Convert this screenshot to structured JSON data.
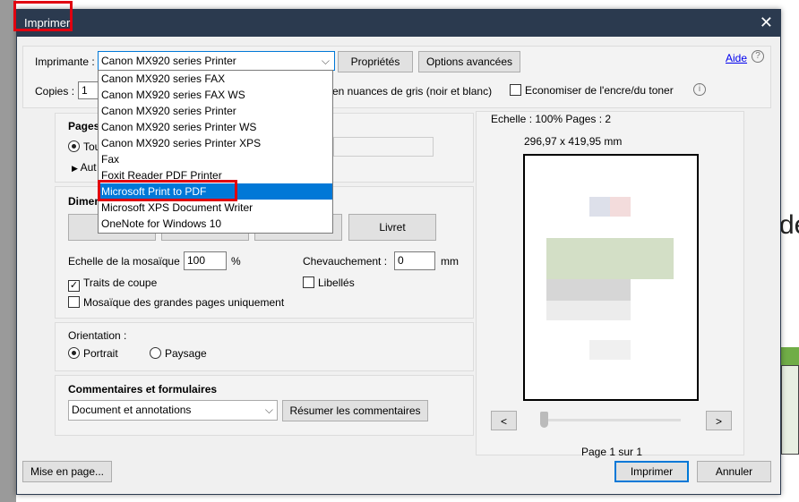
{
  "dialog": {
    "title": "Imprimer",
    "close": "✕"
  },
  "printer": {
    "label": "Imprimante :",
    "selected": "Canon MX920 series Printer",
    "properties": "Propriétés",
    "advanced": "Options avancées",
    "help": "Aide",
    "options": [
      "Canon MX920 series FAX",
      "Canon MX920 series FAX WS",
      "Canon MX920 series Printer",
      "Canon MX920 series Printer WS",
      "Canon MX920 series Printer XPS",
      "Fax",
      "Foxit Reader PDF Printer",
      "Microsoft Print to PDF",
      "Microsoft XPS Document Writer",
      "OneNote for Windows 10"
    ],
    "highlighted_index": 7
  },
  "copies": {
    "label": "Copies :",
    "value": "1",
    "grayscale": "en nuances de gris (noir et blanc)",
    "save_ink": "Economiser de l'encre/du toner"
  },
  "pages": {
    "title": "Pages",
    "all": "Tou",
    "more": "Aut"
  },
  "size": {
    "title": "Dimer",
    "booklet": "Livret",
    "tile_scale_label": "Echelle de la mosaïque :",
    "tile_scale": "100",
    "pct": "%",
    "overlap_label": "Chevauchement :",
    "overlap": "0",
    "mm": "mm",
    "cut_marks": "Traits de coupe",
    "labels": "Libellés",
    "large_only": "Mosaïque des grandes pages uniquement"
  },
  "orientation": {
    "title": "Orientation :",
    "portrait": "Portrait",
    "landscape": "Paysage"
  },
  "comments": {
    "title": "Commentaires et formulaires",
    "selected": "Document et annotations",
    "summarize": "Résumer les commentaires"
  },
  "preview": {
    "scale": "Echelle : 100% Pages : 2",
    "dimensions": "296,97 x 419,95 mm",
    "prev": "<",
    "next": ">",
    "page_info": "Page 1 sur 1",
    "slider_value": 0
  },
  "footer": {
    "page_setup": "Mise en page...",
    "print": "Imprimer",
    "cancel": "Annuler"
  },
  "background": {
    "text": "de"
  }
}
